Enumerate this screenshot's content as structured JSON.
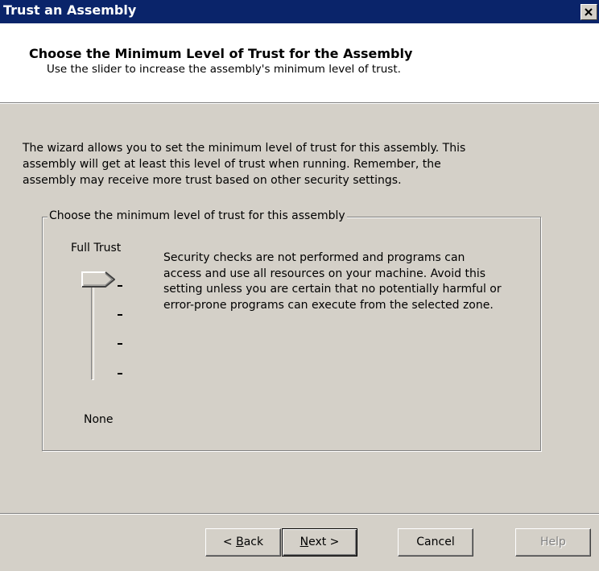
{
  "window": {
    "title": "Trust an Assembly"
  },
  "header": {
    "title": "Choose the Minimum Level of Trust for the Assembly",
    "subtitle": "Use the slider to increase the assembly's minimum level of trust."
  },
  "intro": {
    "lines": [
      "The wizard allows you to set the minimum level of trust for this assembly.  This",
      "assembly will get at least this level of trust when running.  Remember, the",
      "assembly may receive more trust based on other security settings."
    ]
  },
  "trust_group": {
    "legend": "Choose the minimum level of trust for this assembly",
    "slider": {
      "top_label": "Full Trust",
      "bottom_label": "None",
      "levels": 4,
      "selected_level": 4
    },
    "description_lines": [
      "Security checks are not performed and programs can",
      "access and use all resources on your machine.  Avoid this",
      "setting unless you are certain that no potentially harmful or",
      "error-prone programs can execute from the selected zone."
    ]
  },
  "buttons": {
    "back": {
      "prefix": "< ",
      "mnemonic": "B",
      "rest": "ack"
    },
    "next": {
      "mnemonic": "N",
      "rest": "ext >"
    },
    "cancel": "Cancel",
    "help": "Help"
  }
}
